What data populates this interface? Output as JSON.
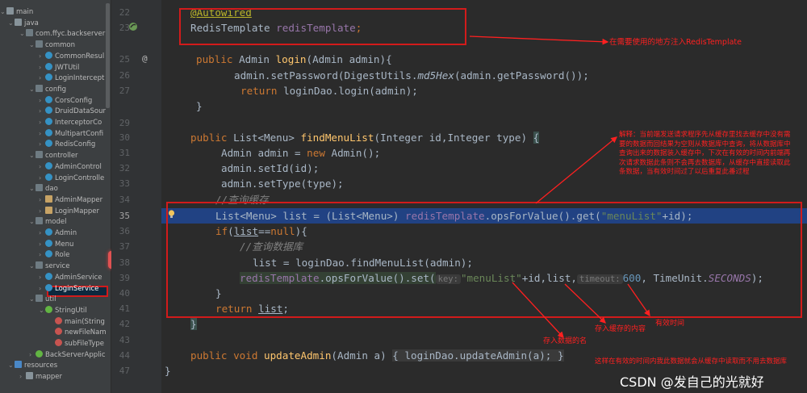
{
  "tree": [
    {
      "label": "main",
      "icon": "folder",
      "expanded": true
    },
    {
      "label": "java",
      "icon": "folder",
      "expanded": true
    },
    {
      "label": "com.ffyc.backserver",
      "icon": "package",
      "expanded": true
    },
    {
      "label": "common",
      "icon": "package",
      "expanded": true
    },
    {
      "label": "CommonResul",
      "icon": "class"
    },
    {
      "label": "JWTUtil",
      "icon": "class"
    },
    {
      "label": "LoginIntercept",
      "icon": "class"
    },
    {
      "label": "config",
      "icon": "package",
      "expanded": true
    },
    {
      "label": "CorsConfig",
      "icon": "class"
    },
    {
      "label": "DruidDataSour",
      "icon": "class"
    },
    {
      "label": "InterceptorCo",
      "icon": "class"
    },
    {
      "label": "MultipartConfi",
      "icon": "class"
    },
    {
      "label": "RedisConfig",
      "icon": "class"
    },
    {
      "label": "controller",
      "icon": "package",
      "expanded": true
    },
    {
      "label": "AdminControl",
      "icon": "class"
    },
    {
      "label": "LoginControlle",
      "icon": "class"
    },
    {
      "label": "dao",
      "icon": "package",
      "expanded": true
    },
    {
      "label": "AdminMapper",
      "icon": "mapper"
    },
    {
      "label": "LoginMapper",
      "icon": "mapper"
    },
    {
      "label": "model",
      "icon": "package",
      "expanded": true
    },
    {
      "label": "Admin",
      "icon": "class"
    },
    {
      "label": "Menu",
      "icon": "class"
    },
    {
      "label": "Role",
      "icon": "class"
    },
    {
      "label": "service",
      "icon": "package",
      "expanded": true
    },
    {
      "label": "AdminService",
      "icon": "class"
    },
    {
      "label": "LoginService",
      "icon": "class",
      "selected": true
    },
    {
      "label": "util",
      "icon": "package",
      "expanded": true
    },
    {
      "label": "StringUtil",
      "icon": "interface",
      "expanded": true
    },
    {
      "label": "main(String",
      "icon": "method"
    },
    {
      "label": "newFileNam",
      "icon": "method"
    },
    {
      "label": "subFileType",
      "icon": "method"
    },
    {
      "label": "BackServerApplic",
      "icon": "interface"
    },
    {
      "label": "resources",
      "icon": "resources",
      "expanded": true
    },
    {
      "label": "mapper",
      "icon": "folder"
    }
  ],
  "line_numbers": [
    "22",
    "23",
    "25",
    "26",
    "27",
    "29",
    "30",
    "31",
    "32",
    "33",
    "34",
    "35",
    "36",
    "37",
    "38",
    "39",
    "40",
    "41",
    "42",
    "43",
    "44",
    "47"
  ],
  "code": {
    "l22_annotation": "@Autowired",
    "l23_type": "RedisTemplate ",
    "l23_field": "redisTemplate",
    "l23_end": ";",
    "l25_kw": "public ",
    "l25_type": "Admin ",
    "l25_fn": "login",
    "l25_params": "(Admin admin){",
    "l26_a": "admin.setPassword(DigestUtils.",
    "l26_it": "md5Hex",
    "l26_b": "(admin.getPassword());",
    "l27_kw": "return ",
    "l27_rest": "loginDao.login(admin);",
    "l29_brace": "}",
    "l30_kw": "public ",
    "l30_type": "List<Menu> ",
    "l30_fn": "findMenuList",
    "l30_params": "(Integer id,Integer type) ",
    "l30_brace": "{",
    "l31_a": "Admin admin = ",
    "l31_kw": "new ",
    "l31_b": "Admin();",
    "l32": "admin.setId(id);",
    "l33": "admin.setType(type);",
    "l34_comment": "//查询缓存",
    "l35_a": "List<Menu> list = (List<Menu>) ",
    "l35_field": "redisTemplate",
    "l35_b": ".opsForValue().get(",
    "l35_str": "\"menuList\"",
    "l35_c": "+id);",
    "l36_kw": "if",
    "l36_a": "(",
    "l36_var": "list",
    "l36_b": "==",
    "l36_null": "null",
    "l36_c": "){",
    "l37_comment": "//查询数据库",
    "l38": "list = loginDao.findMenuList(admin);",
    "l39_field": "redisTemplate",
    "l39_a": ".opsForValue().set(",
    "l39_hint_key": "key:",
    "l39_str": "\"menuList\"",
    "l39_b": "+id,list,",
    "l39_hint_timeout": "timeout:",
    "l39_num": "600",
    "l39_c": ", TimeUnit.",
    "l39_const": "SECONDS",
    "l39_d": ");",
    "l40_brace": "}",
    "l41_kw": "return ",
    "l41_var": "list",
    "l41_end": ";",
    "l42_brace": "}",
    "l43_kw": "public void ",
    "l43_fn": "updateAdmin",
    "l43_a": "(Admin a) ",
    "l43_b": "{ loginDao.updateAdmin(a); }",
    "l47_brace": "}"
  },
  "notes": {
    "inject": "在需要使用的地方注入RedisTemplate",
    "explain": "解释：当前端发送请求程序先从缓存里找去缓存中没有需要的数据而回结果为空则从数据库中查询，将从数据库中查询出来的数据装入缓存中，下次在有效的时间内前端再次请求数据此条则不会再去数据库，从缓存中直接读取此条数据，当有效时间过了以后重复此番过程",
    "key_name": "存入数据的名",
    "content": "存入缓存的内容",
    "valid_time": "有效时间",
    "bottom": "这样在有效的时间内我此数据就会从缓存中读取而不用去数据库"
  },
  "watermark": "CSDN @发自己的光就好"
}
